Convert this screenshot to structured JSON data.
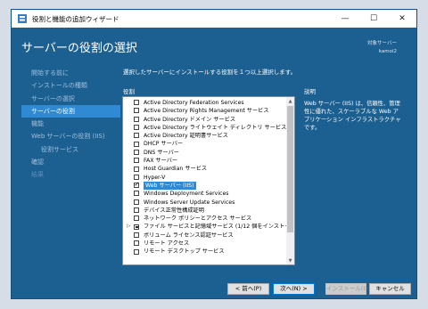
{
  "window": {
    "title": "役割と機能の追加ウィザード",
    "controls": {
      "minimize": "—",
      "maximize": "☐",
      "close": "✕"
    }
  },
  "header": {
    "page_title": "サーバーの役割の選択",
    "server_caption": "対象サーバー",
    "server_name": "kamoi2"
  },
  "nav": {
    "items": [
      {
        "label": "開始する前に",
        "state": "normal"
      },
      {
        "label": "インストールの種類",
        "state": "normal"
      },
      {
        "label": "サーバーの選択",
        "state": "normal"
      },
      {
        "label": "サーバーの役割",
        "state": "active"
      },
      {
        "label": "機能",
        "state": "normal"
      },
      {
        "label": "Web サーバーの役割 (IIS)",
        "state": "normal"
      },
      {
        "label": "役割サービス",
        "state": "sub"
      },
      {
        "label": "確認",
        "state": "normal"
      },
      {
        "label": "結果",
        "state": "disabled"
      }
    ]
  },
  "content": {
    "instruction": "選択したサーバーにインストールする役割を１つ以上選択します。",
    "roles_label": "役割",
    "description_label": "説明",
    "description_text": "Web サーバー (IIS) は、信頼性、管理性に優れた、スケーラブルな Web アプリケーション インフラストラクチャです。"
  },
  "roles": [
    {
      "label": "Active Directory Federation Services",
      "state": "unchecked"
    },
    {
      "label": "Active Directory Rights Management サービス",
      "state": "unchecked"
    },
    {
      "label": "Active Directory ドメイン サービス",
      "state": "unchecked"
    },
    {
      "label": "Active Directory ライトウェイト ディレクトリ サービス",
      "state": "unchecked"
    },
    {
      "label": "Active Directory 証明書サービス",
      "state": "unchecked"
    },
    {
      "label": "DHCP サーバー",
      "state": "unchecked"
    },
    {
      "label": "DNS サーバー",
      "state": "unchecked"
    },
    {
      "label": "FAX サーバー",
      "state": "unchecked"
    },
    {
      "label": "Host Guardian サービス",
      "state": "unchecked"
    },
    {
      "label": "Hyper-V",
      "state": "unchecked"
    },
    {
      "label": "Web サーバー (IIS)",
      "state": "checked",
      "selected": true
    },
    {
      "label": "Windows Deployment Services",
      "state": "unchecked"
    },
    {
      "label": "Windows Server Update Services",
      "state": "unchecked"
    },
    {
      "label": "デバイス正常性構成証明",
      "state": "unchecked"
    },
    {
      "label": "ネットワーク ポリシーとアクセス サービス",
      "state": "unchecked"
    },
    {
      "label": "ファイル サービスと記憶域サービス (1/12 個をインストール済",
      "state": "partial",
      "expander": "▷"
    },
    {
      "label": "ボリューム ライセンス認証サービス",
      "state": "unchecked"
    },
    {
      "label": "リモート アクセス",
      "state": "unchecked"
    },
    {
      "label": "リモート デスクトップ サービス",
      "state": "unchecked"
    }
  ],
  "buttons": {
    "back": "< 前へ(P)",
    "next": "次へ(N) >",
    "install": "インストール(I)",
    "cancel": "キャンセル"
  },
  "colors": {
    "window_bg": "#1c5f91",
    "nav_active": "#2f8ad3",
    "selection": "#2f8ad3"
  }
}
